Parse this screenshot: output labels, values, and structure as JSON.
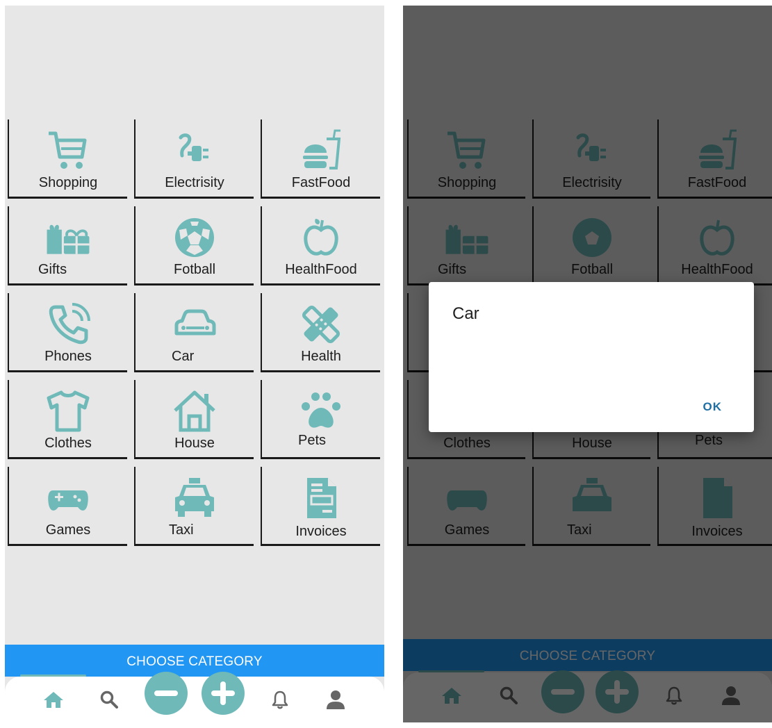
{
  "categories": [
    {
      "label": "Shopping",
      "icon": "shopping-cart-icon"
    },
    {
      "label": "Electrisity",
      "icon": "plug-icon"
    },
    {
      "label": "FastFood",
      "icon": "burger-drink-icon"
    },
    {
      "label": "Gifts",
      "icon": "gift-icon"
    },
    {
      "label": "Fotball",
      "icon": "soccer-ball-icon"
    },
    {
      "label": "HealthFood",
      "icon": "apple-icon"
    },
    {
      "label": "Phones",
      "icon": "phone-icon"
    },
    {
      "label": "Car",
      "icon": "car-icon"
    },
    {
      "label": "Health",
      "icon": "bandage-icon"
    },
    {
      "label": "Clothes",
      "icon": "shirt-icon"
    },
    {
      "label": "House",
      "icon": "house-icon"
    },
    {
      "label": "Pets",
      "icon": "paw-icon"
    },
    {
      "label": "Games",
      "icon": "gamepad-icon"
    },
    {
      "label": "Taxi",
      "icon": "taxi-icon"
    },
    {
      "label": "Invoices",
      "icon": "invoice-icon"
    }
  ],
  "choose_label": "CHOOSE CATEGORY",
  "nav": [
    "home-icon",
    "search-icon",
    "minus-icon",
    "plus-icon",
    "bell-icon",
    "user-icon"
  ],
  "dialog": {
    "title": "Car",
    "ok_label": "OK"
  },
  "colors": {
    "accent": "#6fb9b9",
    "bar": "#2196f3",
    "background": "#e7e7e7",
    "dialog_button": "#1e6fa3"
  }
}
